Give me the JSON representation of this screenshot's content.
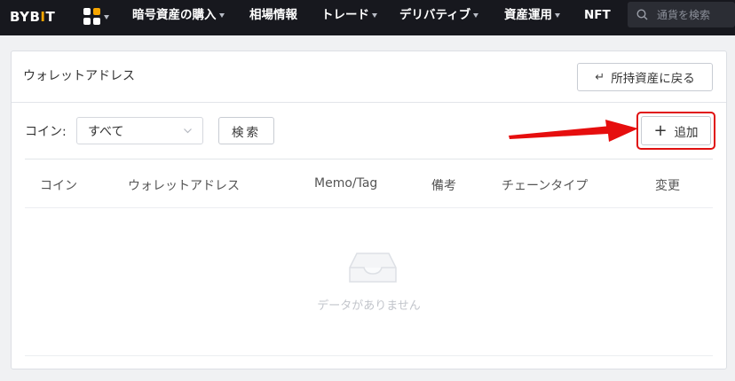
{
  "nav": {
    "logo_left": "BYB",
    "logo_accent": "I",
    "logo_right": "T",
    "items": [
      {
        "label": "暗号資産の購入",
        "caret": true
      },
      {
        "label": "相場情報",
        "caret": false
      },
      {
        "label": "トレード",
        "caret": true
      },
      {
        "label": "デリバティブ",
        "caret": true
      },
      {
        "label": "資産運用",
        "caret": true
      },
      {
        "label": "NFT",
        "caret": false
      }
    ],
    "search_placeholder": "通貨を検索"
  },
  "panel": {
    "title": "ウォレットアドレス",
    "back_label": "所持資産に戻る",
    "back_icon": "return-arrow-icon",
    "filter_label": "コイン:",
    "filter_value": "すべて",
    "search_label": "検索",
    "add_label": "追加"
  },
  "table": {
    "headers": [
      "コイン",
      "ウォレットアドレス",
      "Memo/Tag",
      "備考",
      "チェーンタイプ",
      "変更"
    ],
    "rows": [],
    "empty_text": "データがありません"
  },
  "colors": {
    "nav_bg": "#17181e",
    "brand_accent": "#f7a600",
    "highlight_red": "#e01010"
  }
}
